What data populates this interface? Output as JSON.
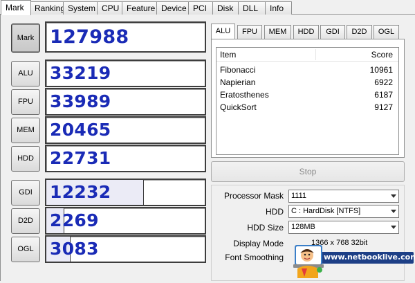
{
  "tabs": [
    "Mark",
    "Ranking",
    "System",
    "CPU",
    "Feature",
    "Device",
    "PCI",
    "Disk",
    "DLL",
    "Info"
  ],
  "scores": [
    {
      "label": "Mark",
      "value": "127988",
      "fill": 0
    },
    {
      "label": "ALU",
      "value": "33219",
      "fill": 0
    },
    {
      "label": "FPU",
      "value": "33989",
      "fill": 0
    },
    {
      "label": "MEM",
      "value": "20465",
      "fill": 0
    },
    {
      "label": "HDD",
      "value": "22731",
      "fill": 0
    },
    {
      "label": "GDI",
      "value": "12232",
      "fill": 0.61
    },
    {
      "label": "D2D",
      "value": "2269",
      "fill": 0.11
    },
    {
      "label": "OGL",
      "value": "3083",
      "fill": 0.15
    }
  ],
  "subtabs": [
    "ALU",
    "FPU",
    "MEM",
    "HDD",
    "GDI",
    "D2D",
    "OGL"
  ],
  "list": {
    "headers": {
      "item": "Item",
      "score": "Score"
    },
    "rows": [
      {
        "item": "Fibonacci",
        "score": "10961"
      },
      {
        "item": "Napierian",
        "score": "6922"
      },
      {
        "item": "Eratosthenes",
        "score": "6187"
      },
      {
        "item": "QuickSort",
        "score": "9127"
      }
    ]
  },
  "stop_label": "Stop",
  "settings": {
    "processor_mask_label": "Processor Mask",
    "processor_mask_value": "1111",
    "hdd_label": "HDD",
    "hdd_value": "C : HardDisk [NTFS]",
    "hdd_size_label": "HDD Size",
    "hdd_size_value": "128MB",
    "display_mode_label": "Display Mode",
    "display_mode_value": "1366 x 768 32bit",
    "font_smoothing_label": "Font Smoothing"
  },
  "watermark": {
    "url": "www.netbooklive.com"
  }
}
